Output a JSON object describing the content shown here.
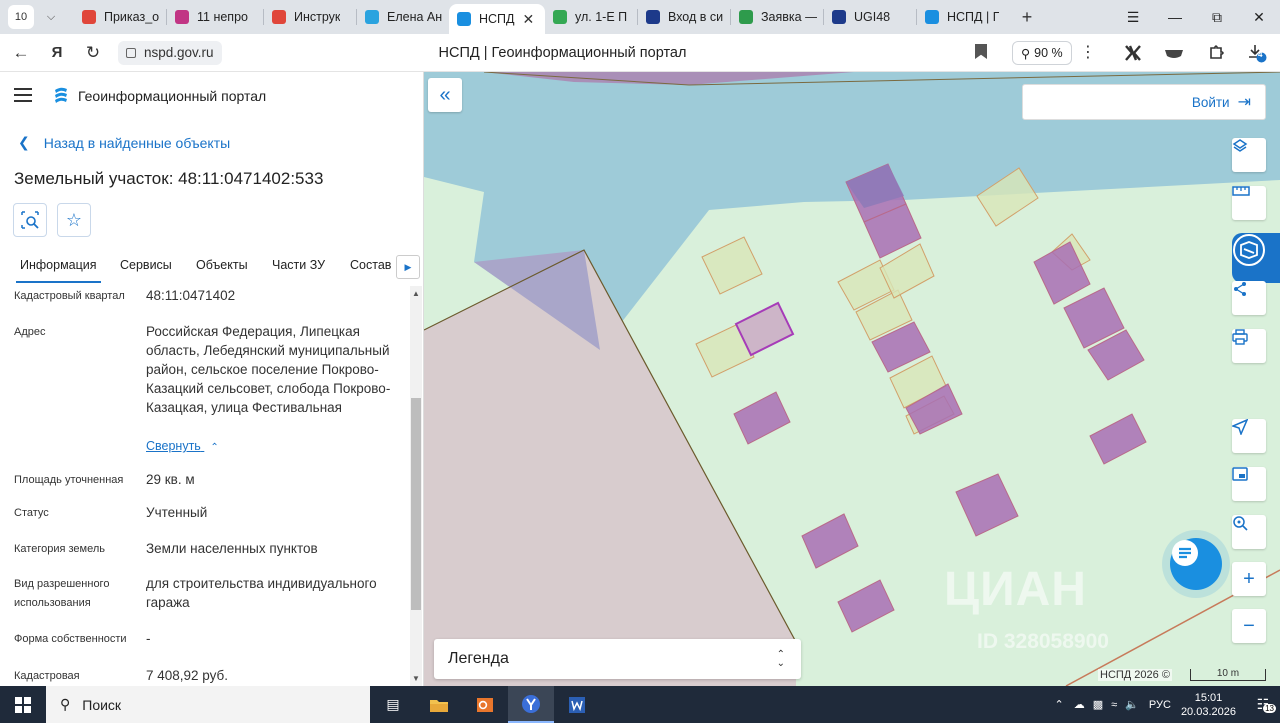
{
  "browser": {
    "tab_count": "10",
    "tabs": [
      {
        "title": "Приказ_о",
        "color": "#e0463a",
        "glyph": ""
      },
      {
        "title": "11 непро",
        "color": "#c13584",
        "glyph": ""
      },
      {
        "title": "Инструк",
        "color": "#e0463a",
        "glyph": ""
      },
      {
        "title": "Елена Ан",
        "color": "#2aa3df",
        "glyph": ""
      },
      {
        "title": "НСПД",
        "color": "#1a8fe0",
        "glyph": "",
        "active": true
      },
      {
        "title": "ул. 1-Е П",
        "color": "#34a853",
        "glyph": ""
      },
      {
        "title": "Вход в си",
        "color": "#1d3a8a",
        "glyph": ""
      },
      {
        "title": "Заявка —",
        "color": "#2e9b4c",
        "glyph": "M"
      },
      {
        "title": "UGI48",
        "color": "#1d3a8a",
        "glyph": ""
      },
      {
        "title": "НСПД | Г",
        "color": "#1a8fe0",
        "glyph": ""
      }
    ],
    "url": "nspd.gov.ru",
    "page_title": "НСПД | Геоинформационный портал",
    "zoom": "90 %",
    "download_badge": "4"
  },
  "panel": {
    "portal_name": "Геоинформационный портал",
    "back_link": "Назад в найденные объекты",
    "title": "Земельный участок: 48:11:0471402:533",
    "tabs": [
      "Информация",
      "Сервисы",
      "Объекты",
      "Части ЗУ",
      "Состав"
    ],
    "fields": {
      "quarter_label": "Кадастровый квартал",
      "quarter_value": "48:11:0471402",
      "address_label": "Адрес",
      "address_value": "Российская Федерация, Липецкая область, Лебедянский муниципальный район, сельское поселение Покрово-Казацкий сельсовет, слобода Покрово-Казацкая, улица Фестивальная",
      "collapse": "Свернуть",
      "area_label": "Площадь уточненная",
      "area_value": "29 кв. м",
      "status_label": "Статус",
      "status_value": "Учтенный",
      "category_label": "Категория земель",
      "category_value": "Земли населенных пунктов",
      "use_label": "Вид разрешенного использования",
      "use_value": "для строительства индивидуального гаража",
      "ownership_label": "Форма собственности",
      "ownership_value": "-",
      "cadastral_label": "Кадастровая",
      "cadastral_value": "7 408,92 руб."
    }
  },
  "map": {
    "login": "Войти",
    "legend": "Легенда",
    "watermark": "ЦИАН",
    "watermark_id": "ID 328058900",
    "copyright": "НСПД 2026 ©",
    "scale": "10 m"
  },
  "taskbar": {
    "search": "Поиск",
    "lang": "РУС",
    "time": "15:01",
    "date": "20.03.2026",
    "notifications": "13"
  }
}
